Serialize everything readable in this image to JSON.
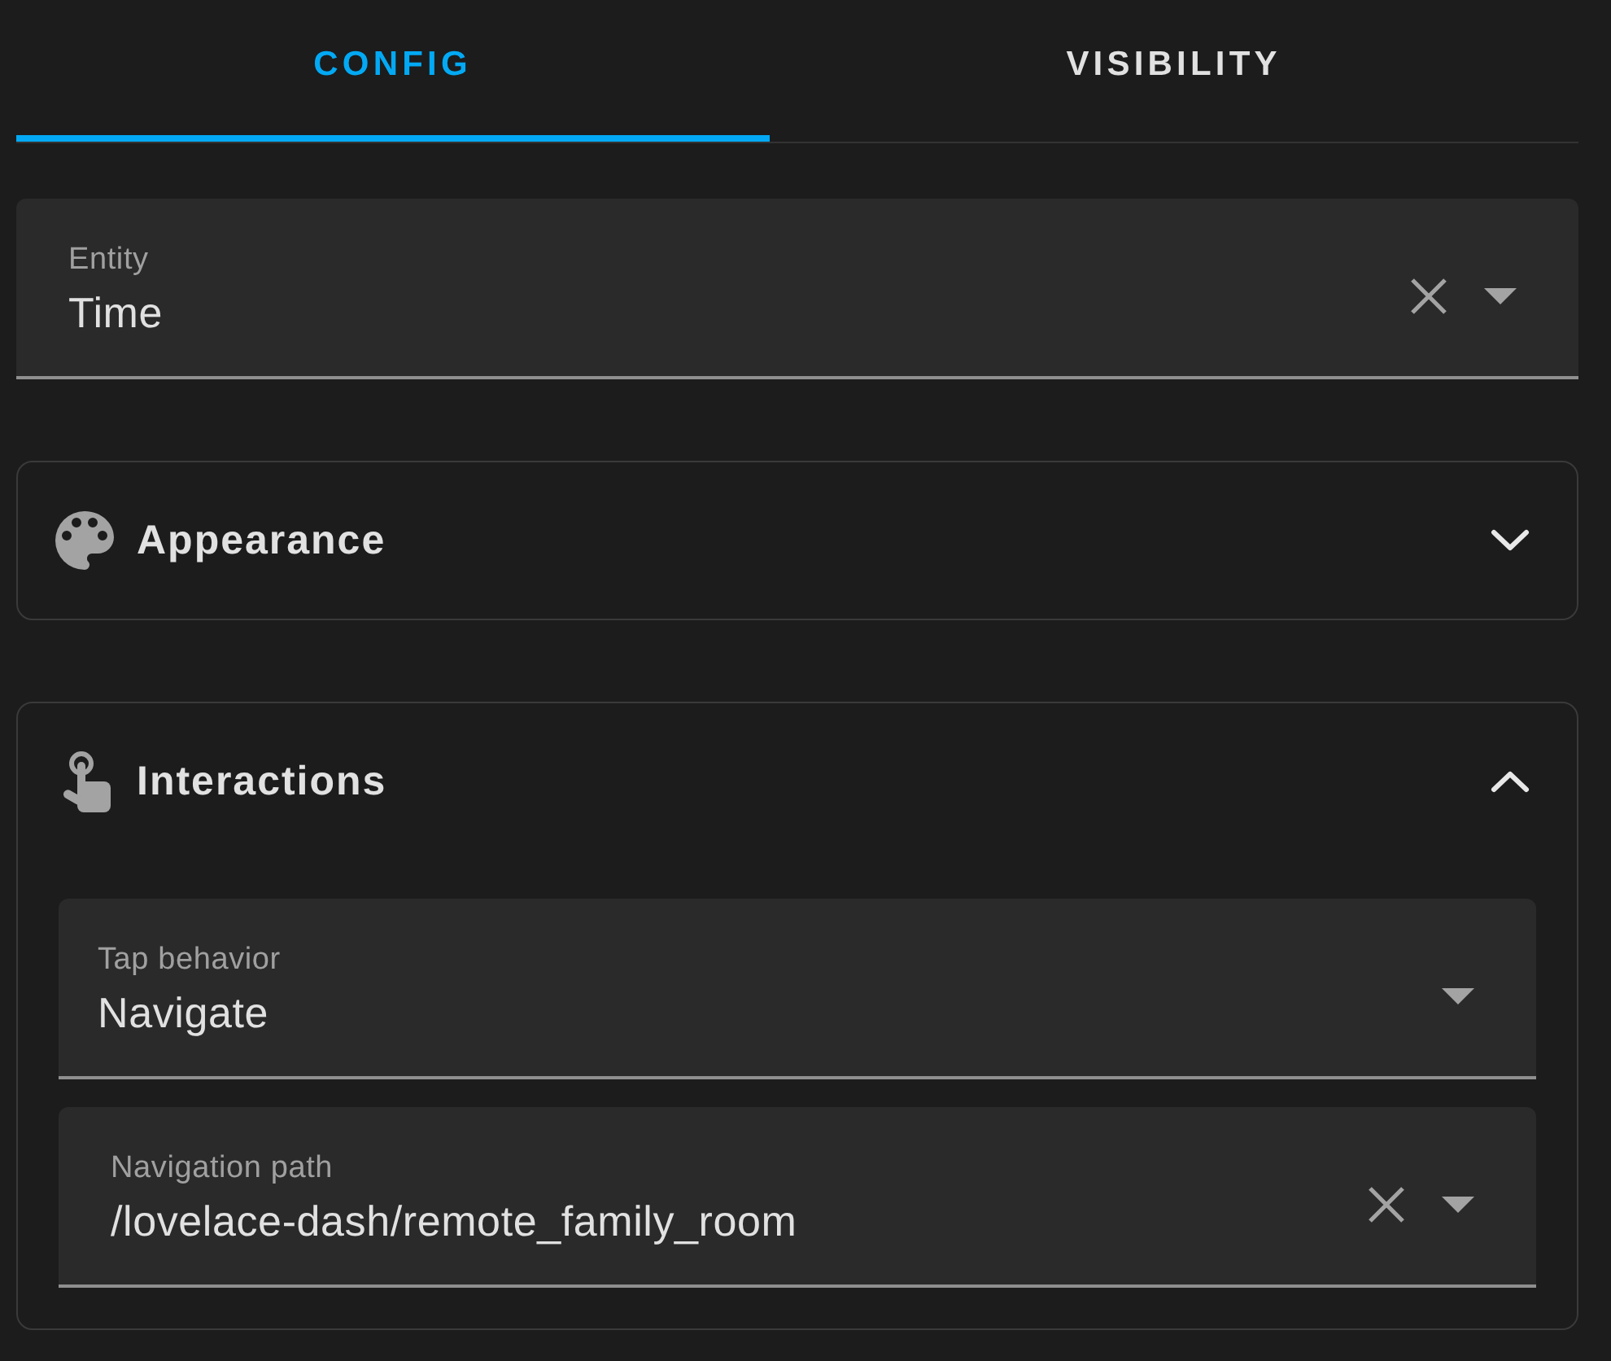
{
  "tabs": [
    {
      "label": "CONFIG",
      "selected": true
    },
    {
      "label": "VISIBILITY",
      "selected": false
    }
  ],
  "entity_field": {
    "kind": "combobox",
    "label": "Entity",
    "value": "Time"
  },
  "sections": [
    {
      "title": "Appearance",
      "expanded": false
    },
    {
      "title": "Interactions",
      "expanded": true,
      "fields": [
        {
          "kind": "select",
          "label": "Tap behavior",
          "value": "Navigate"
        },
        {
          "kind": "combobox",
          "label": "Navigation path",
          "value": "/lovelace-dash/remote_family_room"
        }
      ]
    }
  ]
}
